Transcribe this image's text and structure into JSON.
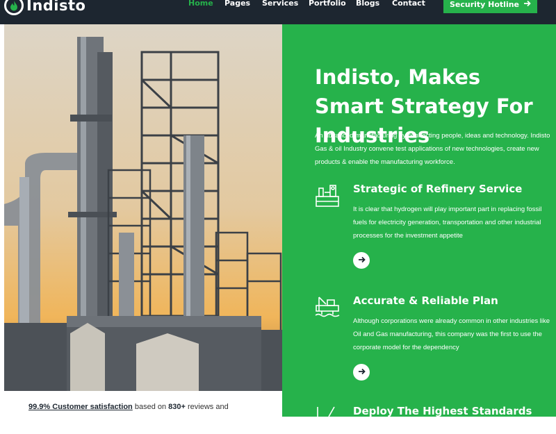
{
  "brand": {
    "name": "Indisto"
  },
  "nav": {
    "items": [
      {
        "label": "Home",
        "active": true
      },
      {
        "label": "Pages",
        "active": false
      },
      {
        "label": "Services",
        "active": false
      },
      {
        "label": "Portfolio",
        "active": false
      },
      {
        "label": "Blogs",
        "active": false
      },
      {
        "label": "Contact",
        "active": false
      }
    ],
    "cta_label": "Security Hotline"
  },
  "hero": {
    "title": "Indisto, Makes Smart Strategy For Industries",
    "description": "An advanced manufacturing by connecting people, ideas and technology. Indisto Gas & oil Industry convene test applications of new technologies, create new products & enable the manufacturing workforce."
  },
  "features": [
    {
      "icon": "refinery-icon",
      "title": "Strategic of Refinery Service",
      "text": "It is clear that hydrogen will play important part in replacing fossil fuels for electricity generation, transportation and other industrial processes for the investment appetite"
    },
    {
      "icon": "oil-rig-icon",
      "title": "Accurate & Reliable Plan",
      "text": "Although corporations were already common in other industries like Oil and Gas manufacturing, this company was the first to use the corporate model for the dependency"
    },
    {
      "icon": "tools-icon",
      "title": "Deploy The Highest Standards",
      "text": ""
    }
  ],
  "stats": {
    "highlight": "99.9% Customer satisfaction",
    "middle": " based on ",
    "count": "830+",
    "suffix": " reviews and"
  },
  "colors": {
    "accent": "#26b24b",
    "topbar": "#1d2630"
  }
}
